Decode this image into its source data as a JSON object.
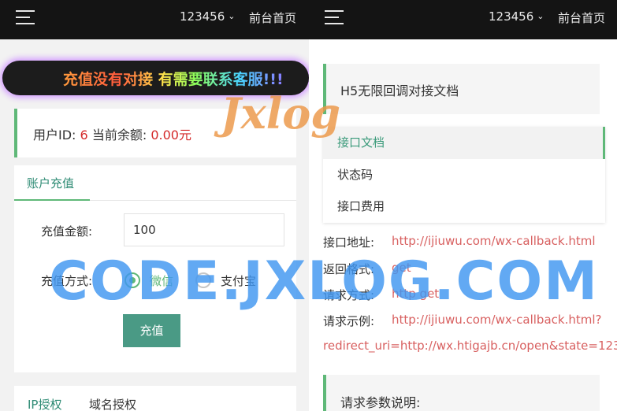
{
  "left_screen": {
    "topbar": {
      "user": "123456",
      "home_link": "前台首页"
    },
    "marquee_text": "充值没有对接 有需要联系客服!!!",
    "balance": {
      "user_id_label": "用户ID:",
      "user_id_value": "6",
      "balance_label": "当前余额:",
      "balance_value": "0.00元"
    },
    "recharge": {
      "tab_title": "账户充值",
      "amount_label": "充值金额:",
      "amount_value": "100",
      "method_label": "充值方式:",
      "method_options": [
        {
          "label": "微信",
          "selected": true
        },
        {
          "label": "支付宝",
          "selected": false
        }
      ],
      "submit_label": "充值"
    },
    "auth_tabs": [
      "IP授权",
      "域名授权"
    ]
  },
  "right_screen": {
    "topbar": {
      "user": "123456",
      "home_link": "前台首页"
    },
    "doc_title": "H5无限回调对接文档",
    "menu": [
      "接口文档",
      "状态码",
      "接口费用"
    ],
    "active_menu_index": 0,
    "api": {
      "address_label": "接口地址:",
      "address_value": "http://ijiuwu.com/wx-callback.html",
      "format_label": "返回格式:",
      "format_value": "get",
      "method_label": "请求方式:",
      "method_value": "http get",
      "example_label": "请求示例:",
      "example_value_line1": "http://ijiuwu.com/wx-callback.html?",
      "example_value_line2": "redirect_uri=http://wx.htigajb.cn/open&state=123"
    },
    "params_title": "请求参数说明:"
  },
  "overlays": {
    "watermark": "CODE.JXLOG.COM",
    "logo": "Jxlog"
  },
  "colors": {
    "topbar_bg": "#141414",
    "accent_green": "#5fb878",
    "button_green": "#4a9a85",
    "value_red": "#d42a2a",
    "link_red": "#d86060",
    "watermark_blue": "#4096f0",
    "logo_orange": "#eb9646",
    "marquee_glow": "#d39cff"
  },
  "icons": [
    "menu-icon",
    "chevron-down-icon",
    "radio-checked-icon",
    "radio-unchecked-icon"
  ]
}
